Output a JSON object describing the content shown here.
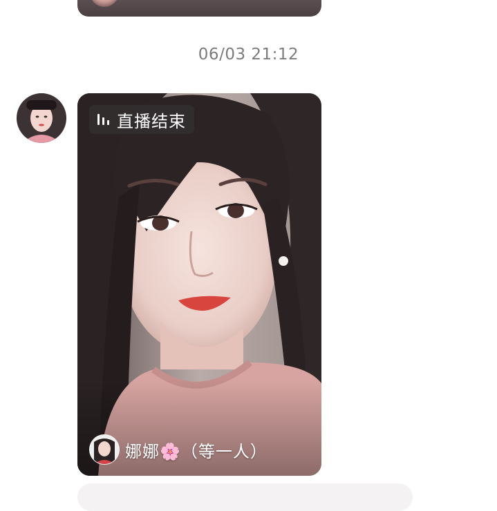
{
  "previous_message": {
    "flower_icon": "🌸"
  },
  "timestamp": "06/03 21:12",
  "live_card": {
    "status_label": "直播结束",
    "status_icon": "live-bars-icon",
    "host_name": "娜娜🌸（等一人）"
  },
  "colors": {
    "timestamp": "#7b7b7b",
    "badge_bg": "rgba(55,55,55,0.55)",
    "lips": "#d8453f",
    "sweater": "#d7a4a1"
  }
}
